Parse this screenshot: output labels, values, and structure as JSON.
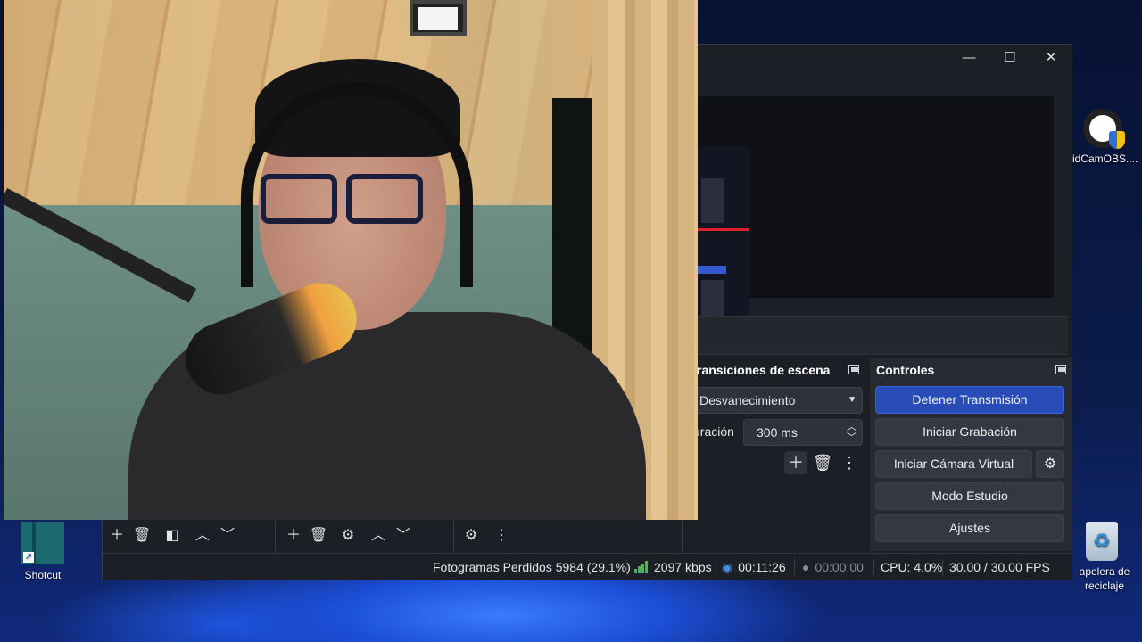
{
  "desktop": {
    "icons": [
      {
        "label": "Shotcut",
        "icon": "shotcut-icon"
      },
      {
        "label": "idCamOBS....",
        "icon": "droidcam-icon"
      },
      {
        "label": "apelera de\nreciclaje",
        "icon": "recycle-bin-icon"
      }
    ]
  },
  "window": {
    "controls": {
      "minimize": "—",
      "maximize": "☐",
      "close": "✕"
    }
  },
  "transitions_dock": {
    "title": "ransiciones de escena",
    "transition_value": "Desvanecimiento",
    "duration_label": "uración",
    "duration_value": "300 ms"
  },
  "controls_dock": {
    "title": "Controles",
    "buttons": {
      "stop_stream": "Detener Transmisión",
      "start_recording": "Iniciar Grabación",
      "start_virtual_cam": "Iniciar Cámara Virtual",
      "studio_mode": "Modo Estudio",
      "settings": "Ajustes"
    }
  },
  "statusbar": {
    "dropped_frames": "Fotogramas Perdidos 5984 (29.1%)",
    "bitrate": "2097 kbps",
    "stream_time": "00:11:26",
    "record_time": "00:00:00",
    "cpu": "CPU: 4.0%",
    "fps": "30.00 / 30.00 FPS"
  },
  "colors": {
    "accent": "#284cb8",
    "bitrate_green": "#3fbf4a",
    "window_bg": "#1d1f26"
  }
}
